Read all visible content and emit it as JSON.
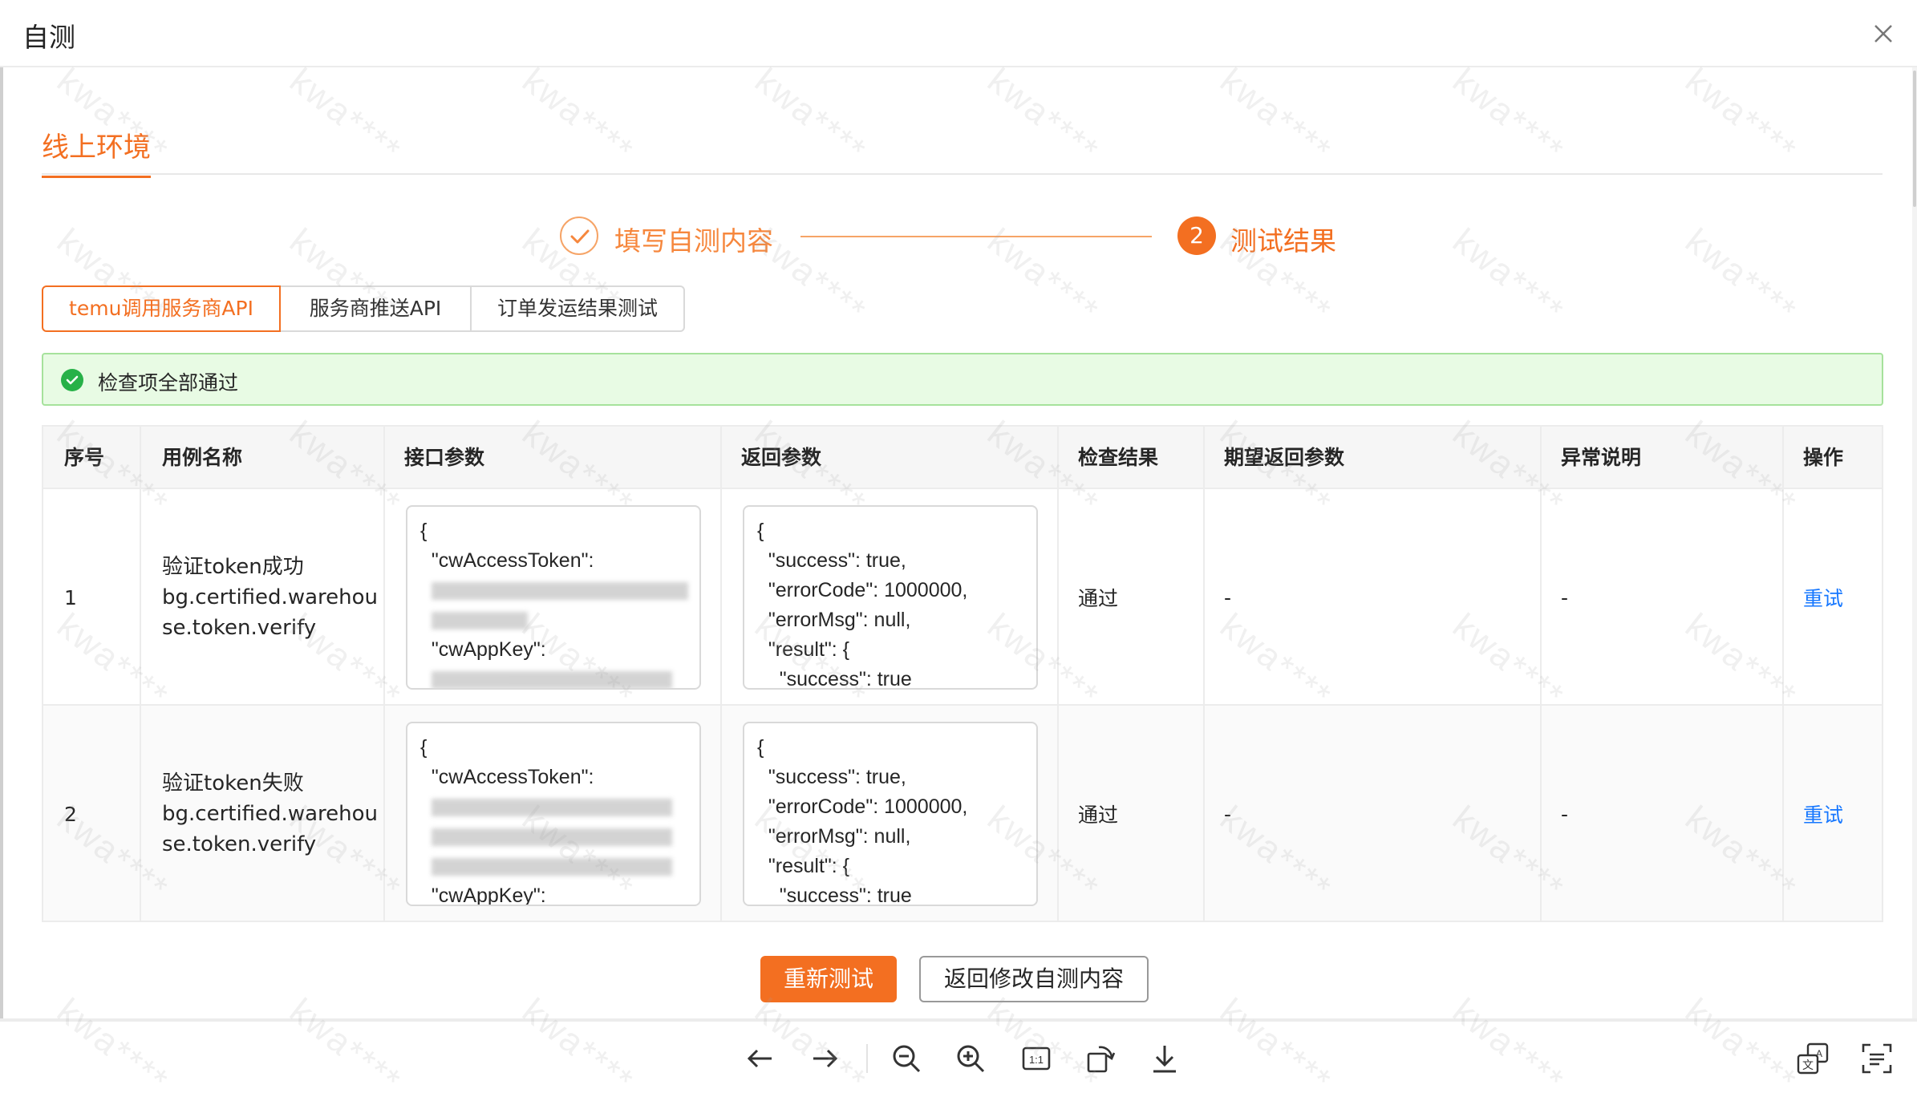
{
  "window": {
    "title": "自测",
    "close_icon": "close-icon"
  },
  "env_tab": {
    "label": "线上环境"
  },
  "steps": [
    {
      "label": "填写自测内容",
      "state": "done",
      "icon": "check-icon"
    },
    {
      "label": "测试结果",
      "state": "active",
      "number": "2"
    }
  ],
  "seg_tabs": [
    {
      "label": "temu调用服务商API",
      "active": true
    },
    {
      "label": "服务商推送API",
      "active": false
    },
    {
      "label": "订单发运结果测试",
      "active": false
    }
  ],
  "alert": {
    "icon": "check-circle-icon",
    "text": "检查项全部通过",
    "color": "#27b148"
  },
  "table": {
    "headers": [
      "序号",
      "用例名称",
      "接口参数",
      "返回参数",
      "检查结果",
      "期望返回参数",
      "异常说明",
      "操作"
    ],
    "rows": [
      {
        "index": "1",
        "case_name_lines": [
          "验证token成功",
          "bg.certified.warehou",
          "se.token.verify"
        ],
        "request_lines": [
          "{",
          "  \"cwAccessToken\":",
          "",
          "",
          "  \"cwAppKey\":"
        ],
        "response_lines": [
          "{",
          "  \"success\": true,",
          "  \"errorCode\": 1000000,",
          "  \"errorMsg\": null,",
          "  \"result\": {",
          "    \"success\": true"
        ],
        "check_result": "通过",
        "expected": "-",
        "exception": "-",
        "action": "重试"
      },
      {
        "index": "2",
        "case_name_lines": [
          "验证token失败",
          "bg.certified.warehou",
          "se.token.verify"
        ],
        "request_lines": [
          "{",
          "  \"cwAccessToken\":",
          "",
          "",
          "",
          "  \"cwAppKey\":"
        ],
        "response_lines": [
          "{",
          "  \"success\": true,",
          "  \"errorCode\": 1000000,",
          "  \"errorMsg\": null,",
          "  \"result\": {",
          "    \"success\": true"
        ],
        "check_result": "通过",
        "expected": "-",
        "exception": "-",
        "action": "重试"
      }
    ]
  },
  "footer": {
    "retest_label": "重新测试",
    "back_label": "返回修改自测内容"
  },
  "viewer_toolbar": {
    "icons": [
      "arrow-left-icon",
      "arrow-right-icon",
      "zoom-out-icon",
      "zoom-in-icon",
      "actual-size-icon",
      "rotate-icon",
      "download-icon",
      "translate-icon",
      "text-recognize-icon"
    ]
  },
  "colors": {
    "accent": "#f36f21",
    "link": "#1677ff",
    "success_bg": "#e8fbe4",
    "success_border": "#a6e29c"
  },
  "watermark": "kwa****"
}
